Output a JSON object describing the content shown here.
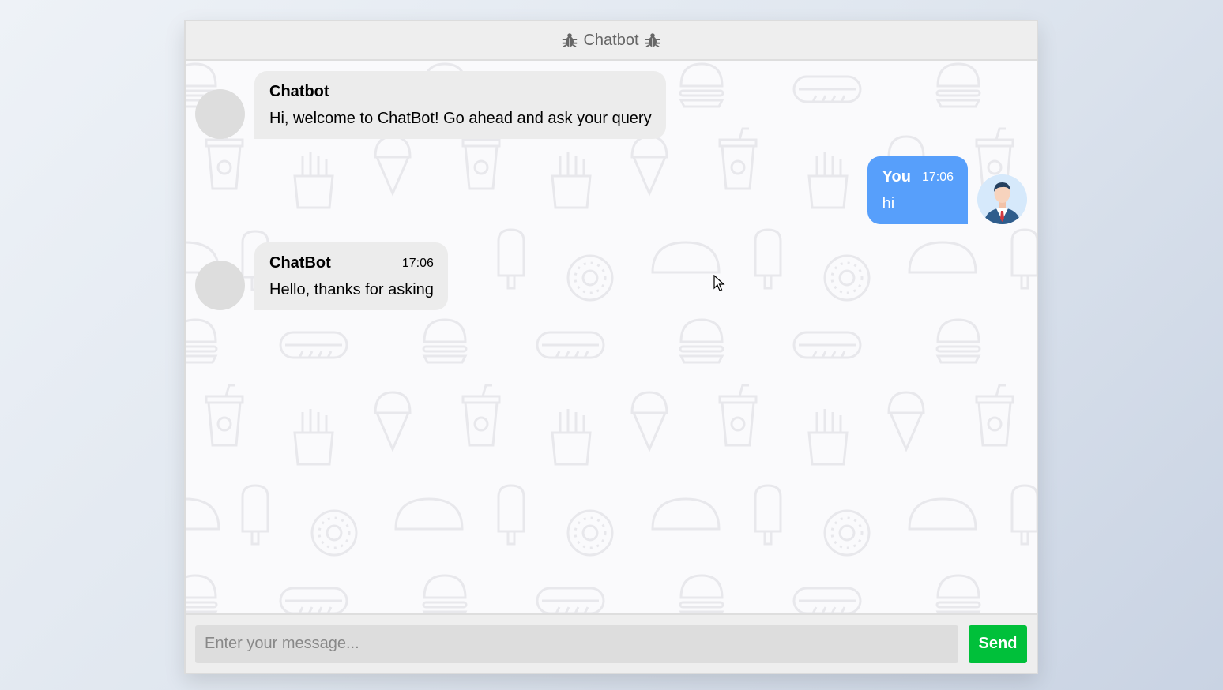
{
  "header": {
    "title": "Chatbot",
    "left_icon": "bug-icon",
    "right_icon": "bug-icon"
  },
  "messages": [
    {
      "side": "left",
      "sender": "Chatbot",
      "time": "",
      "text": "Hi, welcome to ChatBot! Go ahead and ask your query"
    },
    {
      "side": "right",
      "sender": "You",
      "time": "17:06",
      "text": "hi"
    },
    {
      "side": "left",
      "sender": "ChatBot",
      "time": "17:06",
      "text": "Hello, thanks for asking"
    }
  ],
  "input": {
    "placeholder": "Enter your message...",
    "value": ""
  },
  "send_label": "Send",
  "colors": {
    "user_bubble": "#579ffb",
    "bot_bubble": "#ececec",
    "send_button": "#00c03a",
    "header_bg": "#eeeeee"
  }
}
